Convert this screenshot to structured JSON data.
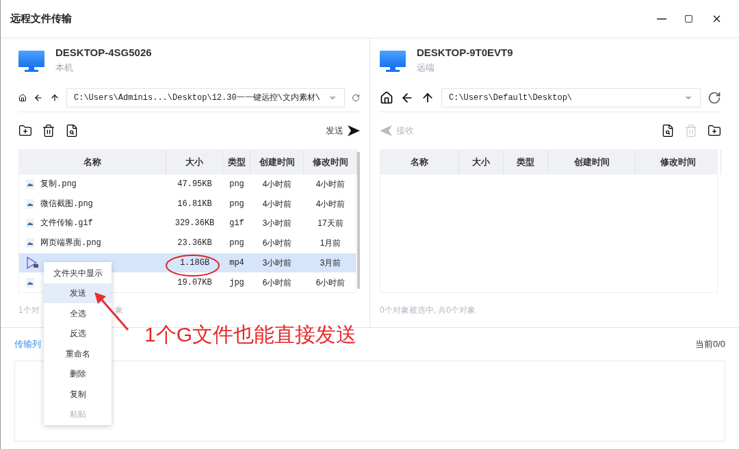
{
  "window": {
    "title": "远程文件传输"
  },
  "local": {
    "host": "DESKTOP-4SG5026",
    "role": "本机",
    "path": "C:\\Users\\Adminis...\\Desktop\\12.30一一键远控\\文内素材\\",
    "action": "发送",
    "columns": [
      "名称",
      "大小",
      "类型",
      "创建时间",
      "修改时间"
    ],
    "rows": [
      {
        "kind": "image",
        "name": "复制.png",
        "size": "47.95KB",
        "type": "png",
        "created": "4小时前",
        "modified": "4小时前",
        "selected": false
      },
      {
        "kind": "image",
        "name": "微信截图.png",
        "size": "16.81KB",
        "type": "png",
        "created": "4小时前",
        "modified": "4小时前",
        "selected": false
      },
      {
        "kind": "image",
        "name": "文件传输.gif",
        "size": "329.36KB",
        "type": "gif",
        "created": "3小时前",
        "modified": "17天前",
        "selected": false
      },
      {
        "kind": "image",
        "name": "网页端界面.png",
        "size": "23.36KB",
        "type": "png",
        "created": "6小时前",
        "modified": "1月前",
        "selected": false
      },
      {
        "kind": "video",
        "size": "1.18GB",
        "type": "mp4",
        "created": "3小时前",
        "modified": "3月前",
        "selected": true
      },
      {
        "kind": "image",
        "size": "19.07KB",
        "type": "jpg",
        "created": "6小时前",
        "modified": "6小时前",
        "selected": false
      }
    ],
    "status": [
      "1个对",
      "象"
    ]
  },
  "remote": {
    "host": "DESKTOP-9T0EVT9",
    "role": "远端",
    "path": "C:\\Users\\Default\\Desktop\\",
    "action": "接收",
    "columns": [
      "名称",
      "大小",
      "类型",
      "创建时间",
      "修改时间"
    ],
    "status": "0个对象被选中, 共0个对象"
  },
  "transfer": {
    "label": "传输列",
    "counter": "当前0/0"
  },
  "context_menu": [
    {
      "label": "文件夹中显示",
      "selected": false,
      "disabled": false
    },
    {
      "label": "发送",
      "selected": true,
      "disabled": false
    },
    {
      "label": "全选",
      "selected": false,
      "disabled": false
    },
    {
      "label": "反选",
      "selected": false,
      "disabled": false
    },
    {
      "label": "重命名",
      "selected": false,
      "disabled": false
    },
    {
      "label": "删除",
      "selected": false,
      "disabled": false
    },
    {
      "label": "复制",
      "selected": false,
      "disabled": false
    },
    {
      "label": "粘贴",
      "selected": false,
      "disabled": true
    }
  ],
  "annotation": {
    "text": "1个G文件也能直接发送"
  }
}
